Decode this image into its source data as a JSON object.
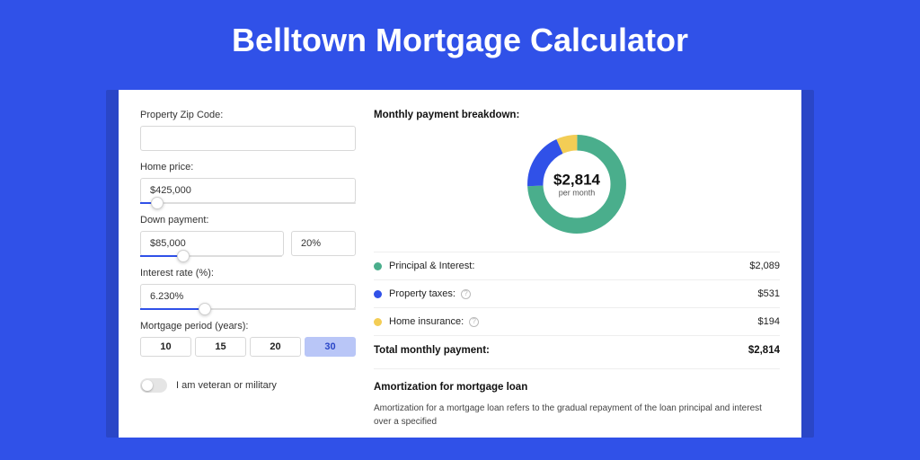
{
  "title": "Belltown Mortgage Calculator",
  "colors": {
    "pi": "#4aae8c",
    "tax": "#3051e8",
    "ins": "#f3cd55"
  },
  "form": {
    "zip_label": "Property Zip Code:",
    "zip_value": "",
    "home_price_label": "Home price:",
    "home_price_value": "$425,000",
    "down_payment_label": "Down payment:",
    "down_payment_amount": "$85,000",
    "down_payment_pct": "20%",
    "interest_label": "Interest rate (%):",
    "interest_value": "6.230%",
    "period_label": "Mortgage period (years):",
    "period_options": [
      "10",
      "15",
      "20",
      "30"
    ],
    "period_selected": "30",
    "veteran_label": "I am veteran or military"
  },
  "breakdown": {
    "heading": "Monthly payment breakdown:",
    "center_amount": "$2,814",
    "center_sub": "per month",
    "items": [
      {
        "key": "pi",
        "label": "Principal & Interest:",
        "value": "$2,089",
        "info": false
      },
      {
        "key": "tax",
        "label": "Property taxes:",
        "value": "$531",
        "info": true
      },
      {
        "key": "ins",
        "label": "Home insurance:",
        "value": "$194",
        "info": true
      }
    ],
    "total_label": "Total monthly payment:",
    "total_value": "$2,814"
  },
  "amortization": {
    "heading": "Amortization for mortgage loan",
    "text": "Amortization for a mortgage loan refers to the gradual repayment of the loan principal and interest over a specified"
  },
  "chart_data": {
    "type": "pie",
    "title": "Monthly payment breakdown",
    "series": [
      {
        "name": "Principal & Interest",
        "value": 2089
      },
      {
        "name": "Property taxes",
        "value": 531
      },
      {
        "name": "Home insurance",
        "value": 194
      }
    ],
    "total": 2814
  }
}
